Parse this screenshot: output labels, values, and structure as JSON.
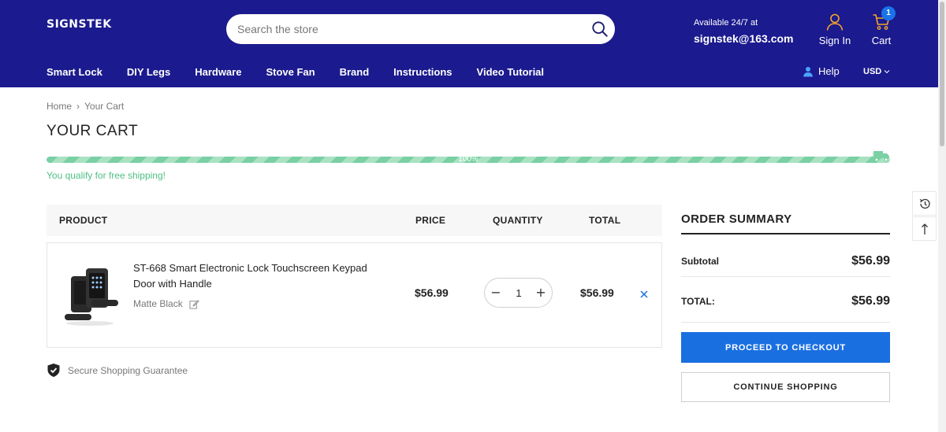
{
  "header": {
    "logo": "SIGNSTEK",
    "search_placeholder": "Search the store",
    "support_line1": "Available 24/7 at",
    "support_email": "signstek@163.com",
    "signin_label": "Sign In",
    "cart_label": "Cart",
    "cart_count": "1",
    "nav": [
      "Smart Lock",
      "DIY Legs",
      "Hardware",
      "Stove Fan",
      "Brand",
      "Instructions",
      "Video Tutorial"
    ],
    "help_label": "Help",
    "currency": "USD",
    "bg_color": "#1b1a8e"
  },
  "breadcrumb": {
    "home": "Home",
    "separator": "›",
    "current": "Your Cart"
  },
  "page_title": "YOUR CART",
  "shipping": {
    "progress_percent": 100,
    "progress_label": "100%",
    "message": "You qualify for free shipping!"
  },
  "table": {
    "headers": {
      "product": "PRODUCT",
      "price": "PRICE",
      "quantity": "QUANTITY",
      "total": "TOTAL"
    },
    "items": [
      {
        "title": "ST-668 Smart Electronic Lock Touchscreen Keypad Door with Handle",
        "variant": "Matte Black",
        "price": "$56.99",
        "quantity": "1",
        "total": "$56.99"
      }
    ]
  },
  "secure_text": "Secure Shopping Guarantee",
  "summary": {
    "title": "ORDER SUMMARY",
    "subtotal_label": "Subtotal",
    "subtotal_value": "$56.99",
    "total_label": "TOTAL:",
    "total_value": "$56.99",
    "checkout_label": "PROCEED TO CHECKOUT",
    "continue_label": "CONTINUE SHOPPING",
    "checkout_color": "#1a6fe0"
  },
  "icons": {
    "search": "search-icon",
    "user": "user-icon",
    "cart": "cart-icon",
    "help": "help-user-icon",
    "truck": "truck-icon",
    "edit": "edit-icon",
    "remove": "close-icon",
    "shield": "shield-check-icon",
    "recent": "history-icon",
    "top": "arrow-up-icon"
  }
}
